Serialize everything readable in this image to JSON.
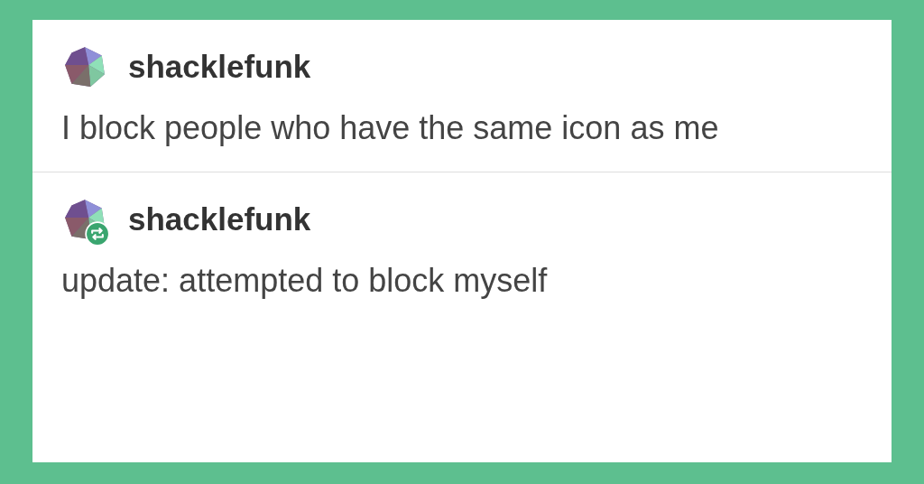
{
  "posts": [
    {
      "username": "shacklefunk",
      "text": "I block people who have the same icon as me",
      "reblogged": false
    },
    {
      "username": "shacklefunk",
      "text": "update: attempted to block myself",
      "reblogged": true
    }
  ]
}
